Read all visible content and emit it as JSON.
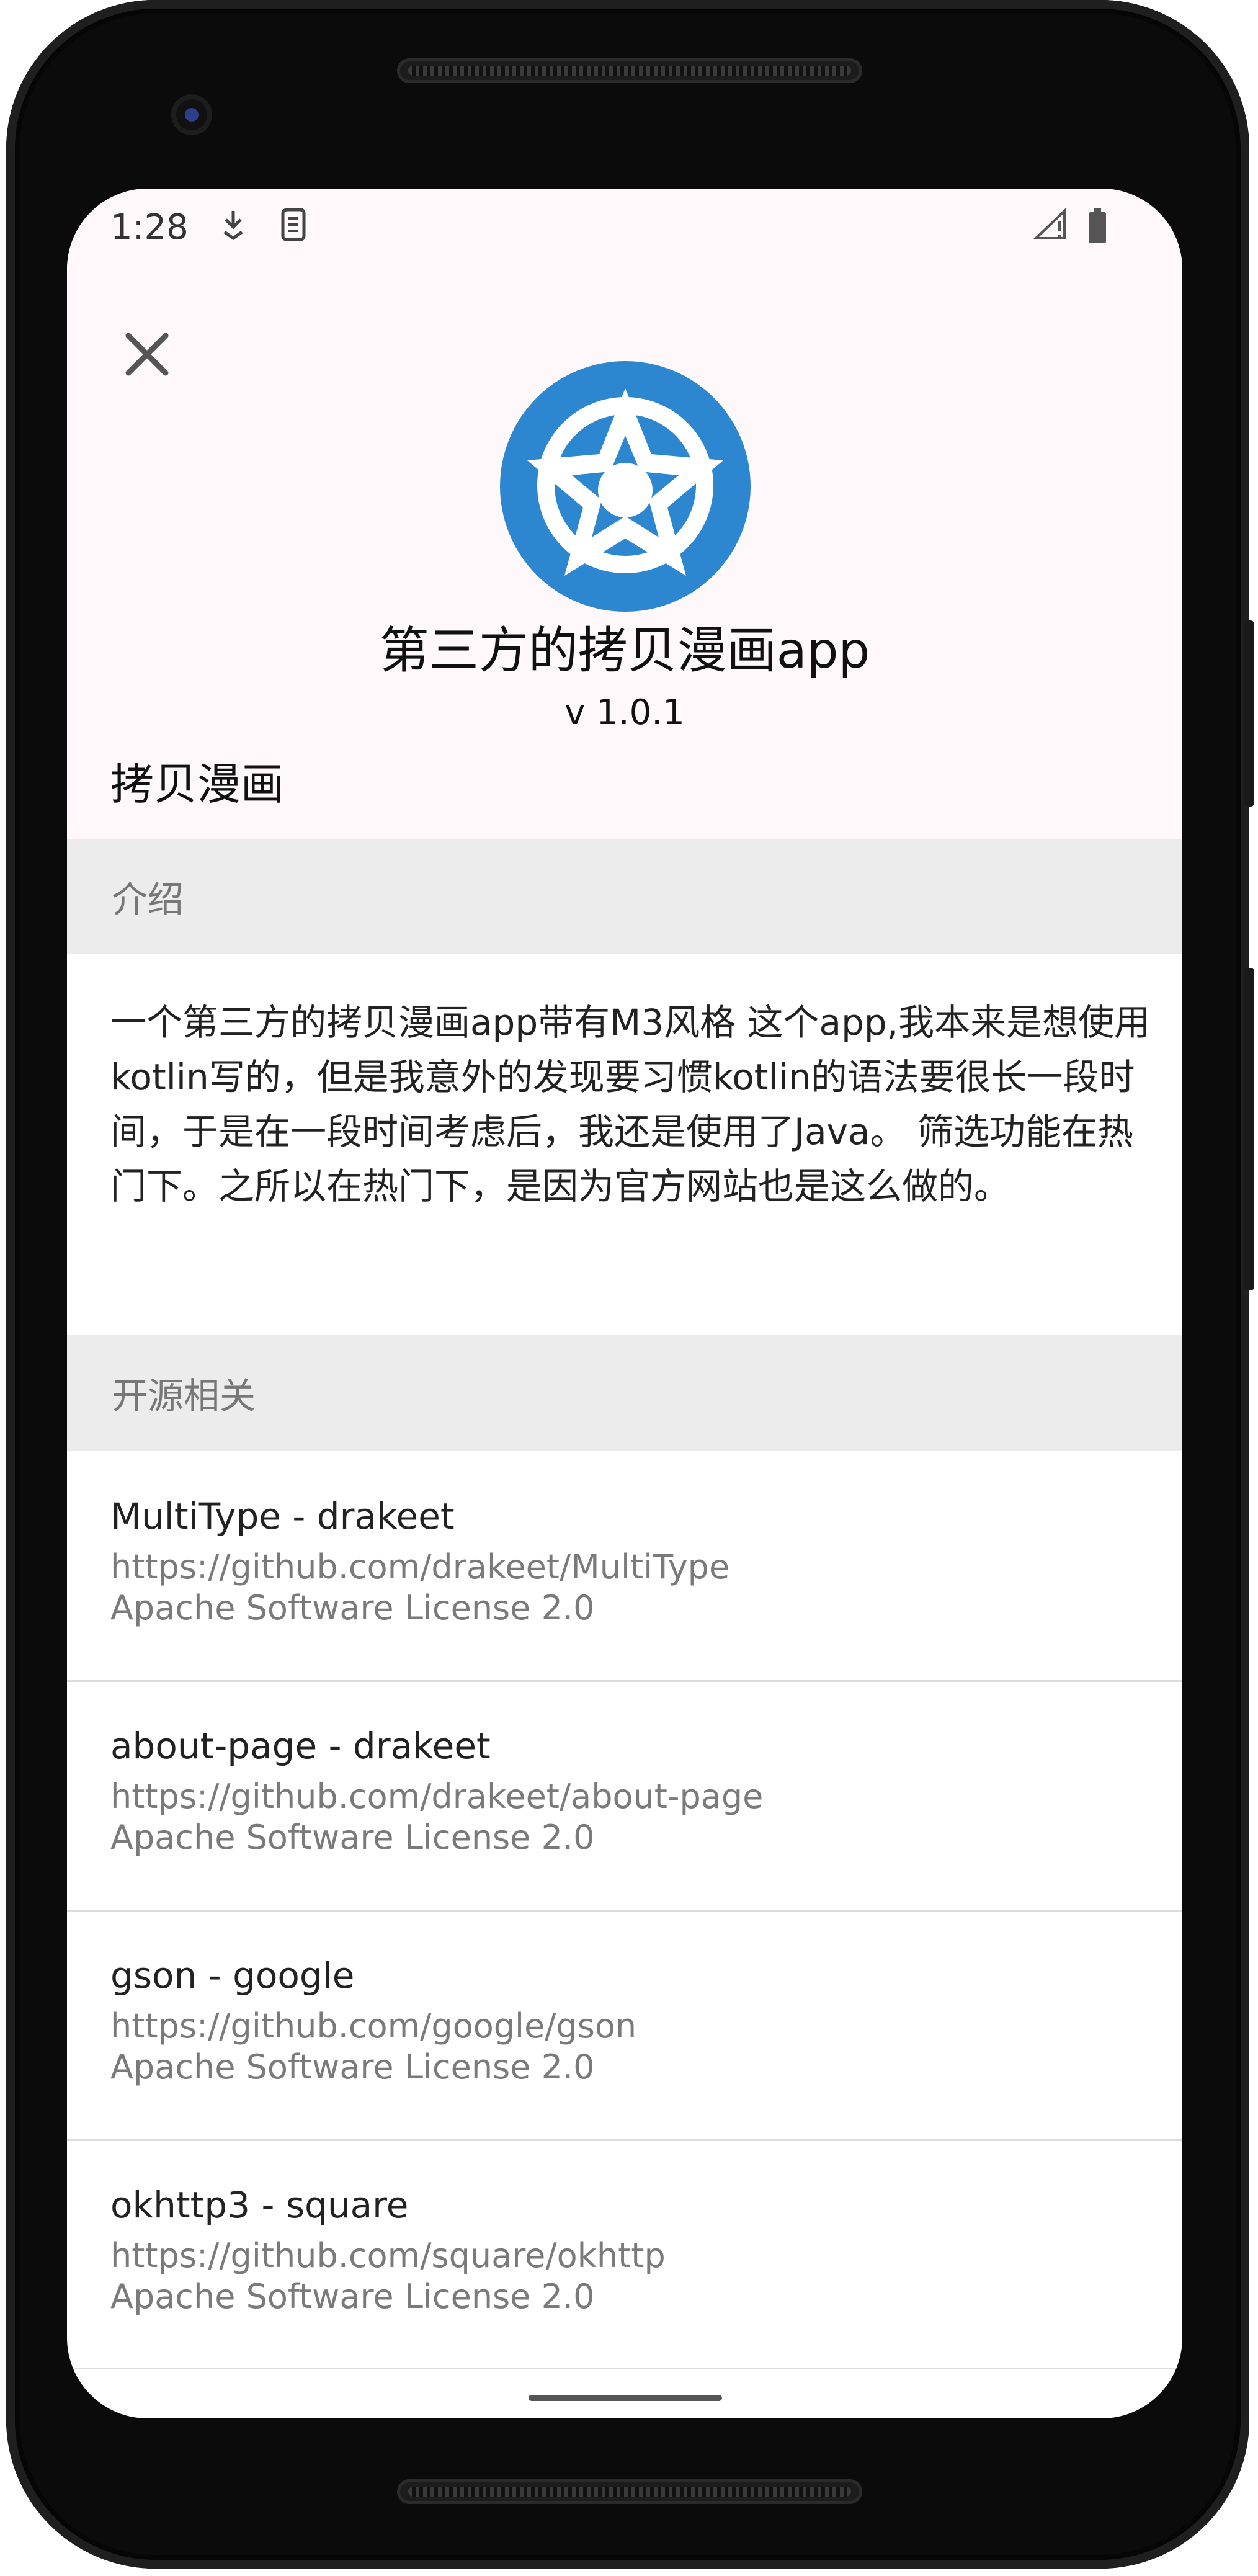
{
  "status_bar": {
    "time": "1:28"
  },
  "colors": {
    "accent": "#2d86d0",
    "header_background": "#fff8fb",
    "section_background": "#ececec"
  },
  "header": {
    "close_icon": "close-icon",
    "logo_icon": "app-logo-icon",
    "title": "第三方的拷贝漫画app",
    "version": "v 1.0.1",
    "app_name": "拷贝漫画"
  },
  "intro": {
    "section_title": "介绍",
    "text": "一个第三方的拷贝漫画app带有M3风格 这个app,我本来是想使用kotlin写的，但是我意外的发现要习惯kotlin的语法要很长一段时间，于是在一段时间考虑后，我还是使用了Java。 筛选功能在热门下。之所以在热门下，是因为官方网站也是这么做的。"
  },
  "open_source": {
    "section_title": "开源相关",
    "items": [
      {
        "name": "MultiType - drakeet",
        "url": "https://github.com/drakeet/MultiType",
        "license": "Apache Software License 2.0"
      },
      {
        "name": "about-page - drakeet",
        "url": "https://github.com/drakeet/about-page",
        "license": "Apache Software License 2.0"
      },
      {
        "name": "gson - google",
        "url": "https://github.com/google/gson",
        "license": "Apache Software License 2.0"
      },
      {
        "name": "okhttp3 - square",
        "url": "https://github.com/square/okhttp",
        "license": "Apache Software License 2.0"
      }
    ]
  }
}
